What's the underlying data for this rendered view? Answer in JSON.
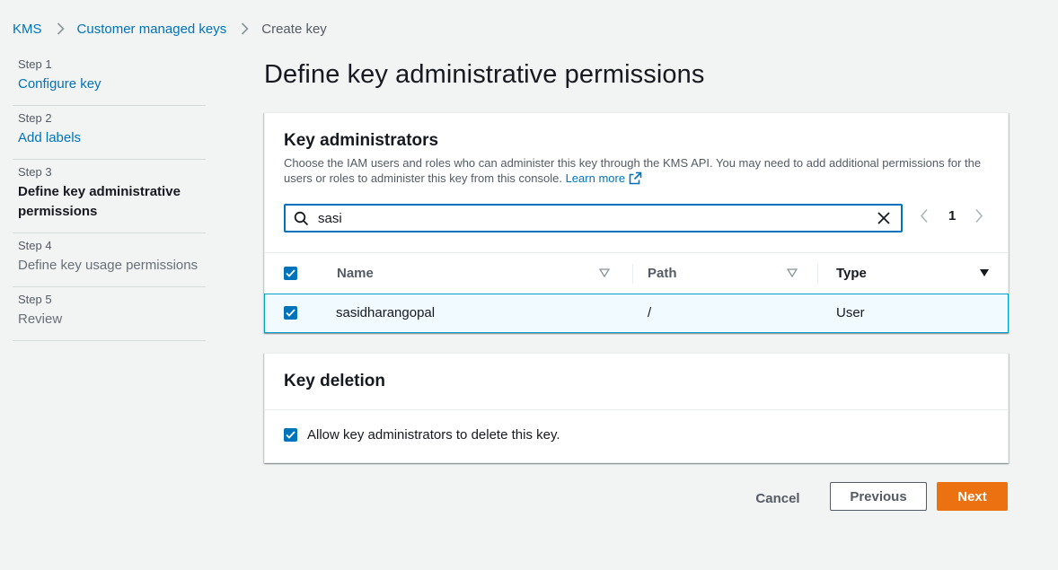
{
  "breadcrumb": {
    "items": [
      "KMS",
      "Customer managed keys"
    ],
    "current": "Create key",
    "separator_icon": "chevron-right-icon"
  },
  "steps": [
    {
      "number": "Step 1",
      "title": "Configure key",
      "state": "link"
    },
    {
      "number": "Step 2",
      "title": "Add labels",
      "state": "link"
    },
    {
      "number": "Step 3",
      "title": "Define key administrative permissions",
      "state": "active"
    },
    {
      "number": "Step 4",
      "title": "Define key usage permissions",
      "state": "disabled"
    },
    {
      "number": "Step 5",
      "title": "Review",
      "state": "disabled"
    }
  ],
  "page": {
    "title": "Define key administrative permissions"
  },
  "key_administrators": {
    "heading": "Key administrators",
    "description": "Choose the IAM users and roles who can administer this key through the KMS API. You may need to add additional permissions for the users or roles to administer this key from this console.",
    "learn_more": "Learn more",
    "search": {
      "value": "sasi",
      "icon": "search-icon",
      "clear_icon": "close-icon"
    },
    "pagination": {
      "current_page": "1",
      "prev_icon": "chevron-left-icon",
      "next_icon": "chevron-right-icon"
    },
    "columns": [
      "Name",
      "Path",
      "Type"
    ],
    "header_checked": true,
    "rows": [
      {
        "checked": true,
        "name": "sasidharangopal",
        "path": "/",
        "type": "User"
      }
    ]
  },
  "key_deletion": {
    "heading": "Key deletion",
    "checkbox_label": "Allow key administrators to delete this key.",
    "checked": true
  },
  "actions": {
    "cancel": "Cancel",
    "previous": "Previous",
    "next": "Next"
  },
  "colors": {
    "link": "#0073bb",
    "primary_button": "#ec7211",
    "selected_row_bg": "#f1faff",
    "selected_row_border": "#00a1c9",
    "checkbox": "#0073bb"
  }
}
